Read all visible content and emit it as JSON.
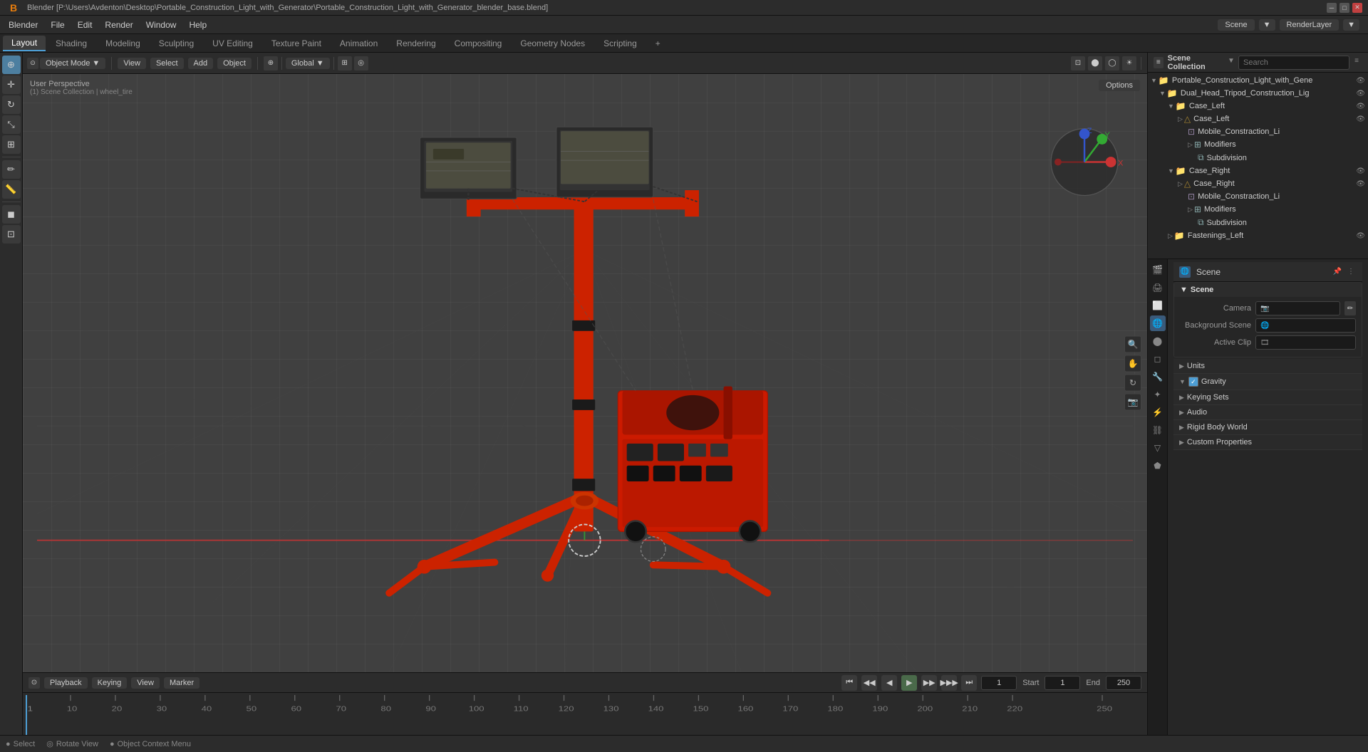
{
  "window": {
    "title": "Blender [P:\\Users\\Avdenton\\Desktop\\Portable_Construction_Light_with_Generator\\Portable_Construction_Light_with_Generator_blender_base.blend]",
    "logo": "B"
  },
  "menubar": {
    "items": [
      "Blender",
      "File",
      "Edit",
      "Render",
      "Window",
      "Help"
    ]
  },
  "workspace_tabs": {
    "tabs": [
      "Layout",
      "Shading",
      "Modeling",
      "Sculpting",
      "UV Editing",
      "Texture Paint",
      "Animation",
      "Rendering",
      "Compositing",
      "Geometry Nodes",
      "Scripting"
    ],
    "active": "Layout",
    "add_label": "+"
  },
  "viewport": {
    "mode": "Object Mode",
    "view_label": "View",
    "select_label": "Select",
    "add_label": "Add",
    "object_label": "Object",
    "transform": "Global",
    "perspective_label": "User Perspective",
    "collection_label": "(1) Scene Collection | wheel_tire",
    "options_label": "Options"
  },
  "left_tools": {
    "tools": [
      "cursor",
      "move",
      "rotate",
      "scale",
      "transform",
      "annotate",
      "measure",
      "add_mesh",
      "add_object"
    ]
  },
  "outliner": {
    "header_label": "Scene Collection",
    "items": [
      {
        "name": "Portable_Construction_Light_with_Gene",
        "level": 1,
        "icon": "▼",
        "type": "collection",
        "visible": true
      },
      {
        "name": "Dual_Head_Tripod_Construction_Lig",
        "level": 2,
        "icon": "▼",
        "type": "collection",
        "visible": true
      },
      {
        "name": "Case_Left",
        "level": 3,
        "icon": "▼",
        "type": "collection",
        "visible": true
      },
      {
        "name": "Case_Left",
        "level": 4,
        "icon": "▷",
        "type": "mesh",
        "visible": true
      },
      {
        "name": "Mobile_Constraction_Li",
        "level": 5,
        "icon": "",
        "type": "mesh",
        "visible": true
      },
      {
        "name": "Modifiers",
        "level": 5,
        "icon": "▷",
        "type": "modifier",
        "visible": true
      },
      {
        "name": "Subdivision",
        "level": 6,
        "icon": "",
        "type": "subdivision",
        "visible": true
      },
      {
        "name": "Case_Right",
        "level": 3,
        "icon": "▼",
        "type": "collection",
        "visible": true
      },
      {
        "name": "Case_Right",
        "level": 4,
        "icon": "▷",
        "type": "mesh",
        "visible": true
      },
      {
        "name": "Mobile_Constraction_Li",
        "level": 5,
        "icon": "",
        "type": "mesh",
        "visible": true
      },
      {
        "name": "Modifiers",
        "level": 5,
        "icon": "▷",
        "type": "modifier",
        "visible": true
      },
      {
        "name": "Subdivision",
        "level": 6,
        "icon": "",
        "type": "subdivision",
        "visible": true
      },
      {
        "name": "Fastenings_Left",
        "level": 3,
        "icon": "▷",
        "type": "collection",
        "visible": true
      }
    ]
  },
  "properties": {
    "active_tab": "scene",
    "tabs": [
      "render",
      "output",
      "view_layer",
      "scene",
      "world",
      "object",
      "modifier",
      "particles",
      "physics",
      "constraints",
      "data",
      "material",
      "texture"
    ],
    "scene_title": "Scene",
    "sections": {
      "scene": {
        "label": "Scene",
        "camera_label": "Camera",
        "camera_value": "",
        "background_scene_label": "Background Scene",
        "background_scene_value": "",
        "active_clip_label": "Active Clip",
        "active_clip_value": ""
      },
      "units": {
        "label": "Units",
        "collapsed": true
      },
      "gravity": {
        "label": "Gravity",
        "checked": true
      },
      "keying_sets": {
        "label": "Keying Sets",
        "collapsed": true
      },
      "audio": {
        "label": "Audio",
        "collapsed": true
      },
      "rigid_body_world": {
        "label": "Rigid Body World",
        "collapsed": true
      },
      "custom_properties": {
        "label": "Custom Properties",
        "collapsed": true
      }
    }
  },
  "timeline": {
    "playback_label": "Playback",
    "keying_label": "Keying",
    "view_label": "View",
    "marker_label": "Marker",
    "current_frame": "1",
    "start_frame": "1",
    "end_frame": "250",
    "start_label": "Start",
    "end_label": "End",
    "frame_marks": [
      "1",
      "10",
      "20",
      "30",
      "40",
      "50",
      "60",
      "70",
      "80",
      "90",
      "100",
      "110",
      "120",
      "130",
      "140",
      "150",
      "160",
      "170",
      "180",
      "190",
      "200",
      "210",
      "220",
      "250"
    ]
  },
  "statusbar": {
    "select_label": "Select",
    "rotate_label": "Rotate View",
    "context_menu_label": "Object Context Menu",
    "select_icon": "●",
    "rotate_icon": "◎",
    "context_icon": "●"
  },
  "colors": {
    "accent": "#4d9ed4",
    "active_object": "#ff4400",
    "grid": "#3a3a3a",
    "axis_x": "#cc2222",
    "axis_y": "#22aa22",
    "axis_z": "#2244cc",
    "header_bg": "#2c2c2c",
    "panel_bg": "#262626",
    "darker_bg": "#1e1e1e"
  }
}
